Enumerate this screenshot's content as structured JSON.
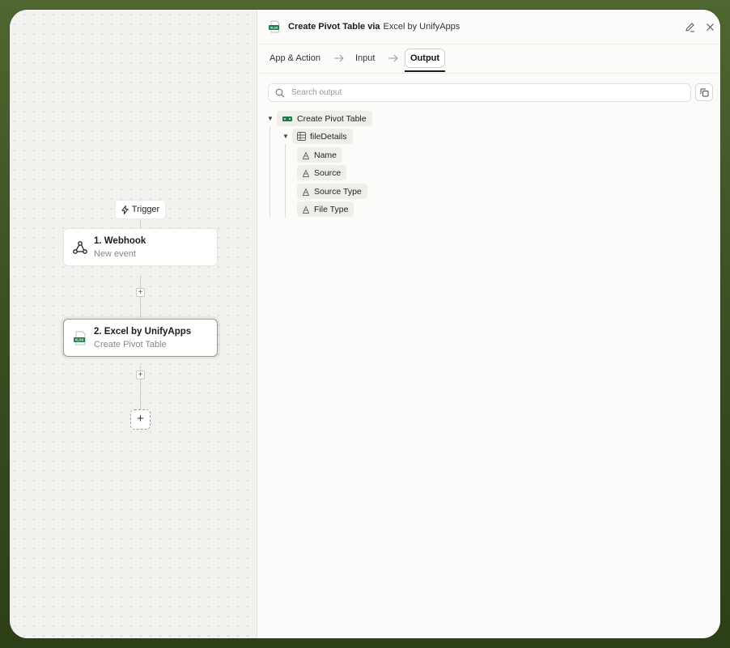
{
  "canvas": {
    "trigger_label": "Trigger",
    "nodes": [
      {
        "title": "1. Webhook",
        "subtitle": "New event",
        "icon": "webhook-icon"
      },
      {
        "title": "2. Excel by UnifyApps",
        "subtitle": "Create Pivot Table",
        "icon": "xlsx-icon"
      }
    ],
    "add_step_symbol": "+",
    "insert_symbol": "+"
  },
  "panel": {
    "app_icon_text": "XLSX",
    "title": "Create Pivot Table via",
    "title_app": "Excel by UnifyApps",
    "tabs": [
      {
        "label": "App & Action"
      },
      {
        "label": "Input"
      },
      {
        "label": "Output",
        "active": true
      }
    ],
    "search_placeholder": "Search output",
    "tree": {
      "root": "Create Pivot Table",
      "group": "fileDetails",
      "fields": [
        "Name",
        "Source",
        "Source Type",
        "File Type"
      ]
    }
  },
  "colors": {
    "frame": "#3f5526",
    "excel_green": "#1e7a46",
    "accent_dark": "#1b1b1b"
  }
}
